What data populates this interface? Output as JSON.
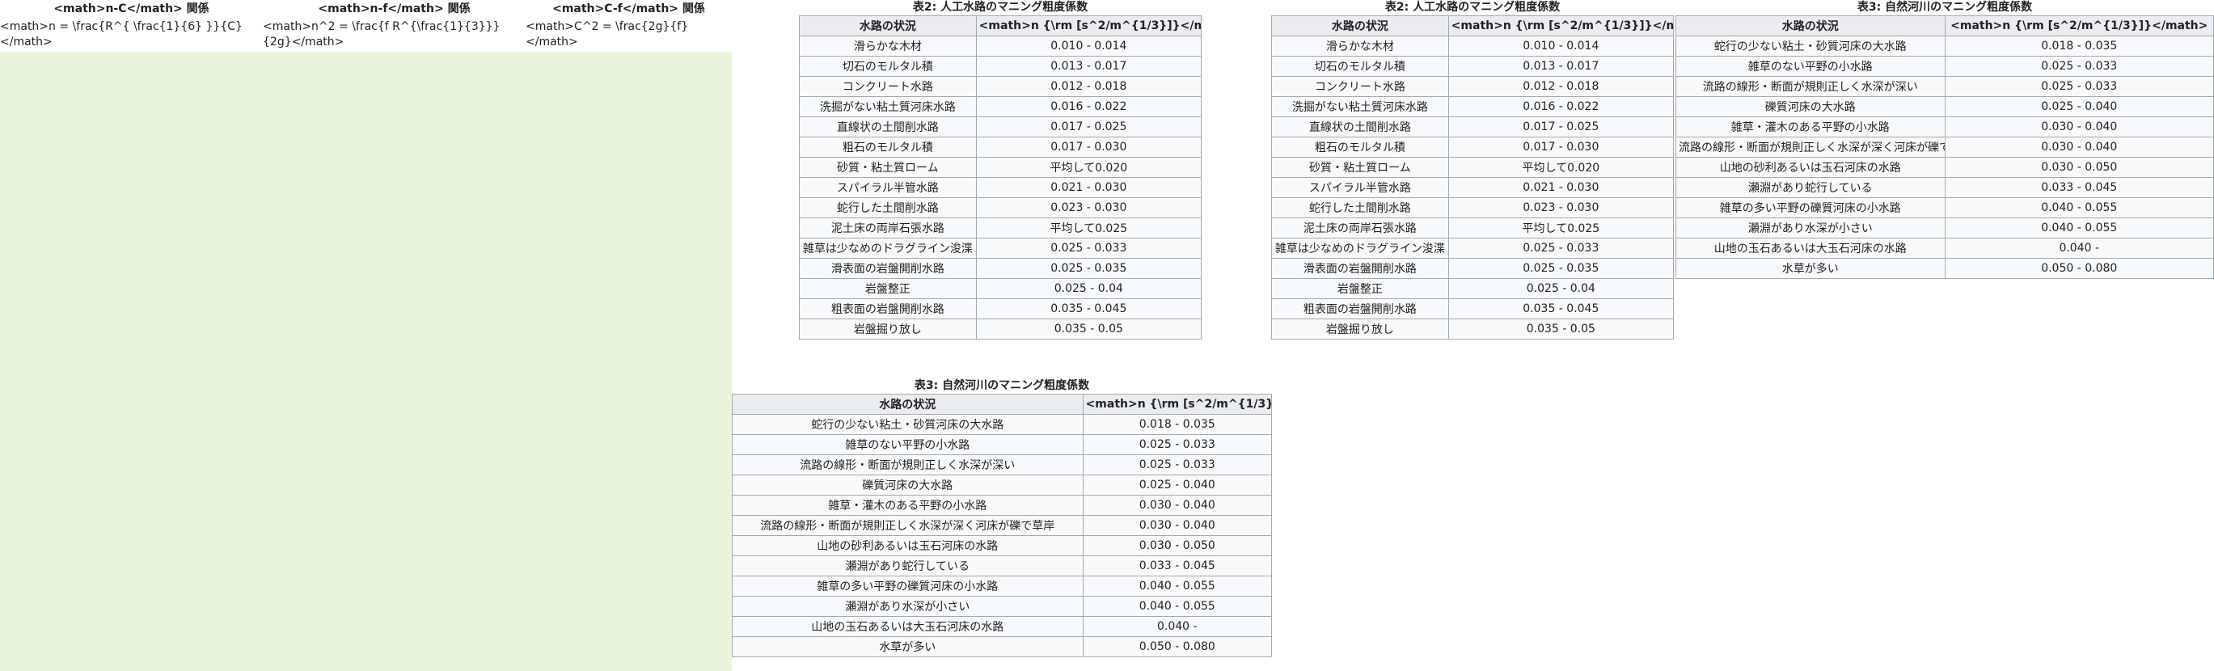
{
  "relations": {
    "headers": [
      "<math>n-C</math> 関係",
      "<math>n-f</math> 関係",
      "<math>C-f</math> 関係"
    ],
    "formulas": [
      "<math>n = \\frac{R^{ \\frac{1}{6} }}{C}</math>",
      "<math>n^2 = \\frac{f R^{\\frac{1}{3}}}{2g}</math>",
      "<math>C^2 = \\frac{2g}{f}</math>"
    ]
  },
  "artificial": {
    "caption": "表2: 人工水路のマニング粗度係数",
    "headers": [
      "水路の状況",
      "<math>n {\\rm [s^2/m^{1/3}]}</math>"
    ],
    "rows": [
      [
        "滑らかな木材",
        "0.010 - 0.014"
      ],
      [
        "切石のモルタル積",
        "0.013 - 0.017"
      ],
      [
        "コンクリート水路",
        "0.012 - 0.018"
      ],
      [
        "洗掘がない粘土質河床水路",
        "0.016 - 0.022"
      ],
      [
        "直線状の土間削水路",
        "0.017 - 0.025"
      ],
      [
        "粗石のモルタル積",
        "0.017 - 0.030"
      ],
      [
        "砂質・粘土質ローム",
        "平均して0.020"
      ],
      [
        "スパイラル半管水路",
        "0.021 - 0.030"
      ],
      [
        "蛇行した土間削水路",
        "0.023 - 0.030"
      ],
      [
        "泥土床の両岸石張水路",
        "平均して0.025"
      ],
      [
        "雑草は少なめのドラグライン浚渫",
        "0.025 - 0.033"
      ],
      [
        "滑表面の岩盤開削水路",
        "0.025 - 0.035"
      ],
      [
        "岩盤整正",
        "0.025 - 0.04"
      ],
      [
        "粗表面の岩盤開削水路",
        "0.035 - 0.045"
      ],
      [
        "岩盤掘り放し",
        "0.035 - 0.05"
      ]
    ]
  },
  "natural": {
    "caption": "表3: 自然河川のマニング粗度係数",
    "headers": [
      "水路の状況",
      "<math>n {\\rm [s^2/m^{1/3}]}</math>"
    ],
    "rows": [
      [
        "蛇行の少ない粘土・砂質河床の大水路",
        "0.018 - 0.035"
      ],
      [
        "雑草のない平野の小水路",
        "0.025 - 0.033"
      ],
      [
        "流路の線形・断面が規則正しく水深が深い",
        "0.025 - 0.033"
      ],
      [
        "礫質河床の大水路",
        "0.025 - 0.040"
      ],
      [
        "雑草・灌木のある平野の小水路",
        "0.030 - 0.040"
      ],
      [
        "流路の線形・断面が規則正しく水深が深く河床が礫で草岸",
        "0.030 - 0.040"
      ],
      [
        "山地の砂利あるいは玉石河床の水路",
        "0.030 - 0.050"
      ],
      [
        "瀬淵があり蛇行している",
        "0.033 - 0.045"
      ],
      [
        "雑草の多い平野の礫質河床の小水路",
        "0.040 - 0.055"
      ],
      [
        "瀬淵があり水深が小さい",
        "0.040 - 0.055"
      ],
      [
        "山地の玉石あるいは大玉石河床の水路",
        "0.040 -"
      ],
      [
        "水草が多い",
        "0.050 - 0.080"
      ]
    ]
  }
}
